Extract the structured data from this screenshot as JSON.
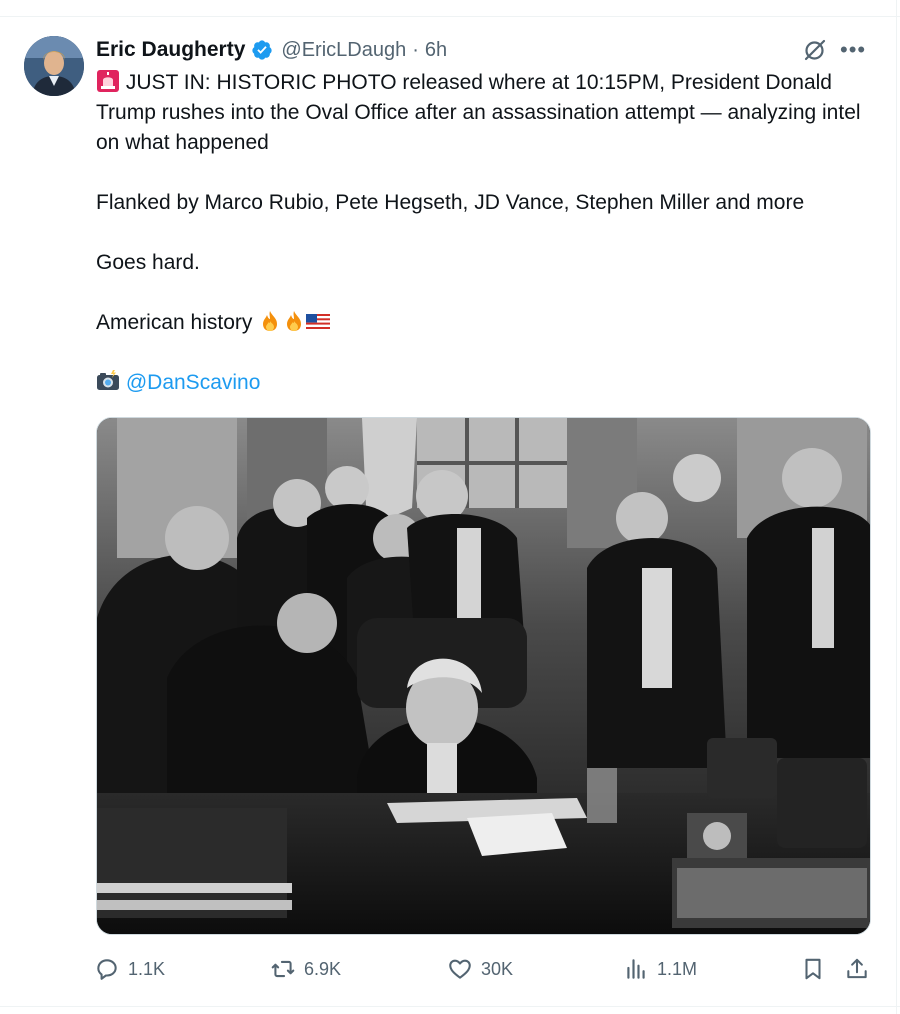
{
  "author": {
    "name": "Eric Daugherty",
    "handle": "@EricLDaugh",
    "separator": "·",
    "time": "6h",
    "verified_color": "#1d9bf0"
  },
  "tweet": {
    "line1": "JUST IN: HISTORIC PHOTO released where at 10:15PM, President Donald Trump rushes into the Oval Office after an assassination attempt — analyzing intel on what happened",
    "line2": "Flanked by Marco Rubio, Pete Hegseth, JD Vance, Stephen Miller and more",
    "line3": "Goes hard.",
    "line4": "American history",
    "mention": "@DanScavino",
    "emojis": [
      "rotating-light",
      "fire",
      "fire",
      "us-flag",
      "camera-flash"
    ]
  },
  "media": {
    "kind": "black-and-white photo of a group in tuxedos gathered around a seated man at a desk"
  },
  "stats": {
    "replies": "1.1K",
    "reposts": "6.9K",
    "likes": "30K",
    "views": "1.1M"
  },
  "colors": {
    "text": "#0f1419",
    "secondary": "#536471",
    "accent": "#1d9bf0",
    "border": "#cfd9de"
  }
}
